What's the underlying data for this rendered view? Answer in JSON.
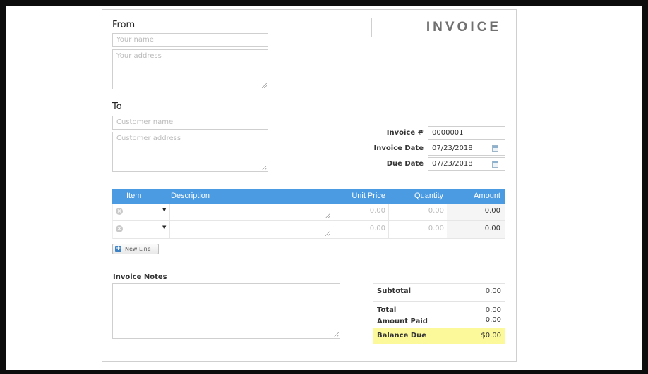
{
  "from": {
    "label": "From",
    "name_placeholder": "Your name",
    "address_placeholder": "Your address"
  },
  "to": {
    "label": "To",
    "name_placeholder": "Customer name",
    "address_placeholder": "Customer address"
  },
  "title": "INVOICE",
  "meta": {
    "invoice_number_label": "Invoice #",
    "invoice_number": "0000001",
    "invoice_date_label": "Invoice Date",
    "invoice_date": "07/23/2018",
    "due_date_label": "Due Date",
    "due_date": "07/23/2018"
  },
  "table": {
    "headers": {
      "item": "Item",
      "description": "Description",
      "unit_price": "Unit Price",
      "quantity": "Quantity",
      "amount": "Amount"
    },
    "rows": [
      {
        "item": "",
        "description": "",
        "unit_price": "0.00",
        "quantity": "0.00",
        "amount": "0.00"
      },
      {
        "item": "",
        "description": "",
        "unit_price": "0.00",
        "quantity": "0.00",
        "amount": "0.00"
      }
    ],
    "new_line_label": "New Line"
  },
  "notes": {
    "label": "Invoice Notes",
    "value": ""
  },
  "summary": {
    "subtotal_label": "Subtotal",
    "subtotal": "0.00",
    "total_label": "Total",
    "total": "0.00",
    "amount_paid_label": "Amount Paid",
    "amount_paid": "0.00",
    "balance_due_label": "Balance Due",
    "balance_due": "$0.00"
  },
  "colors": {
    "table_header": "#4b9be3",
    "balance_highlight": "#fbf99a"
  }
}
